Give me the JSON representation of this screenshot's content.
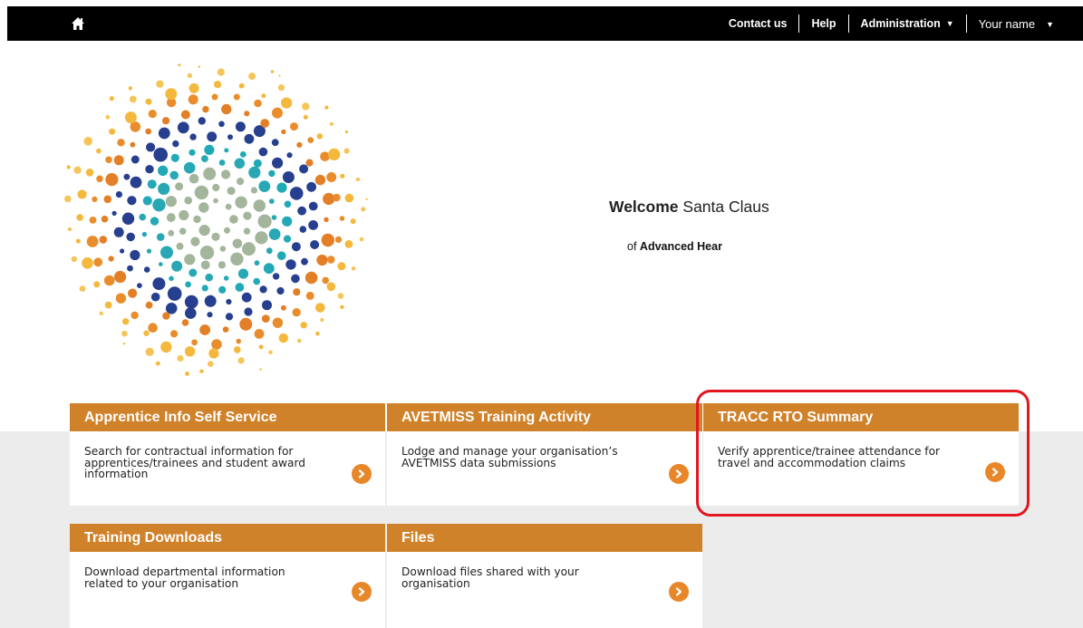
{
  "topbar": {
    "home_icon": "home-icon",
    "contact": "Contact us",
    "help": "Help",
    "administration": "Administration",
    "user": "Your name"
  },
  "welcome": {
    "label": "Welcome",
    "name": "Santa Claus",
    "of": "of",
    "org": "Advanced Hear"
  },
  "tiles": [
    {
      "title": "Apprentice Info Self Service",
      "desc": "Search for contractual information for apprentices/trainees and student award information"
    },
    {
      "title": "AVETMISS Training Activity",
      "desc": "Lodge and manage your organisation’s AVETMISS data submissions"
    },
    {
      "title": "TRACC RTO Summary",
      "desc": "Verify apprentice/trainee attendance for travel and accommodation claims"
    },
    {
      "title": "Training Downloads",
      "desc": "Download departmental information related to your organisation"
    },
    {
      "title": "Files",
      "desc": "Download files shared with your organisation"
    }
  ],
  "colors": {
    "topbar": "#000000",
    "tile_header": "#d0822a",
    "arrow": "#e8872a",
    "band": "#ececec",
    "highlight": "#e3151e"
  }
}
